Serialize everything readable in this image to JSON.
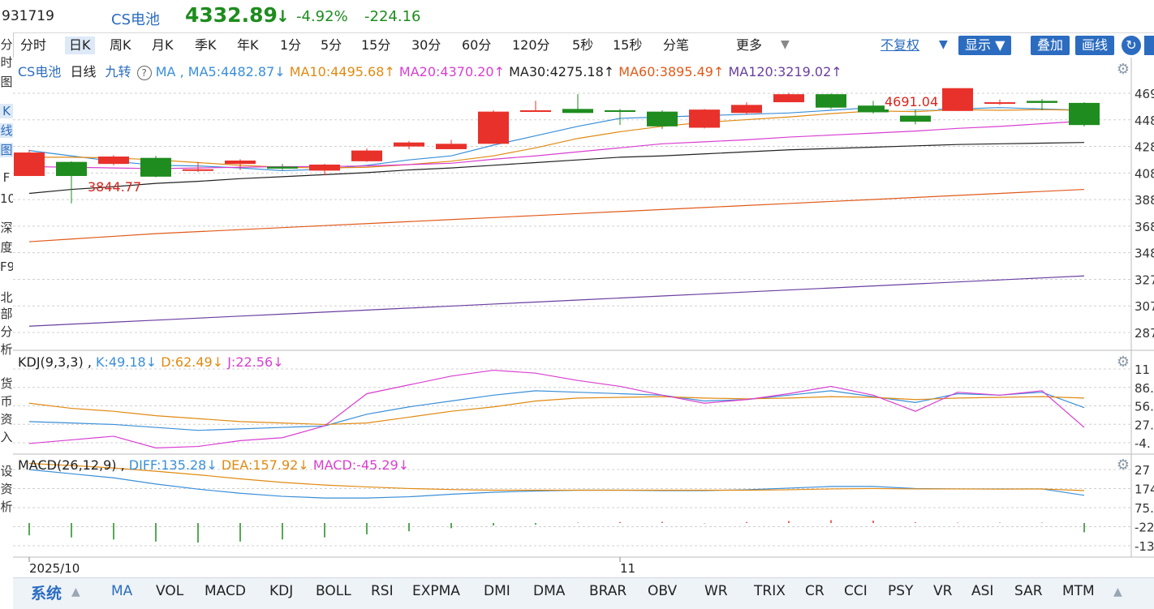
{
  "header": {
    "code": "931719",
    "name": "CS电池",
    "price": "4332.89",
    "arrow": "↓",
    "pct": "-4.92%",
    "change": "-224.16"
  },
  "periods": [
    "分时",
    "日K",
    "周K",
    "月K",
    "季K",
    "年K",
    "1分",
    "5分",
    "15分",
    "30分",
    "60分",
    "120分",
    "5秒",
    "15秒",
    "分笔"
  ],
  "active_period": "日K",
  "more_label": "更多",
  "fq_label": "不复权",
  "buttons": {
    "show": "显示",
    "overlay": "叠加",
    "draw": "画线"
  },
  "left_strip": [
    "分",
    "时",
    "图",
    "K",
    "线",
    "图",
    "F",
    "10",
    "深",
    "度",
    "F9",
    "北",
    "部",
    "分",
    "析",
    "货",
    "币",
    "资",
    "入",
    "设",
    "资",
    "析"
  ],
  "main_legend": {
    "name": "CS电池",
    "period": "日线",
    "indicator": "九转",
    "ma_label": "MA ,",
    "ma5": "MA5:4482.87↓",
    "ma10": "MA10:4495.68↑",
    "ma20": "MA20:4370.20↑",
    "ma30": "MA30:4275.18↑",
    "ma60": "MA60:3895.49↑",
    "ma120": "MA120:3219.02↑"
  },
  "annotations": {
    "high": "4691.04",
    "low": "3844.77"
  },
  "kdj_legend": {
    "name": "KDJ(9,3,3) ,",
    "k": "K:49.18↓",
    "d": "D:62.49↓",
    "j": "J:22.56↓"
  },
  "macd_legend": {
    "name": "MACD(26,12,9) ,",
    "diff": "DIFF:135.28↓",
    "dea": "DEA:157.92↓",
    "macd": "MACD:-45.29↓"
  },
  "price_axis": [
    "469",
    "448",
    "428",
    "408",
    "388",
    "368",
    "348",
    "327",
    "307",
    "287"
  ],
  "kdj_axis": [
    "11",
    "86.",
    "56.",
    "27.",
    "-4."
  ],
  "macd_axis": [
    "27",
    "174",
    "75.",
    "-22",
    "-13"
  ],
  "date_labels": [
    "2025/10",
    "11"
  ],
  "bottom_tabs": [
    "系统",
    "MA",
    "VOL",
    "MACD",
    "KDJ",
    "BOLL",
    "RSI",
    "EXPMA",
    "DMI",
    "DMA",
    "BRAR",
    "OBV",
    "WR",
    "TRIX",
    "CR",
    "CCI",
    "PSY",
    "VR",
    "ASI",
    "SAR",
    "MTM"
  ],
  "colors": {
    "up": "#e8312a",
    "down": "#1e8c1e",
    "ma5": "#3a8fd8",
    "ma10": "#e08a12",
    "ma20": "#d83fd0",
    "ma30": "#222222",
    "ma60": "#e05a1a",
    "ma120": "#6a3fa0",
    "blue_btn": "#2b6cc0"
  },
  "chart_data": {
    "type": "candlestick",
    "ylim": [
      2750,
      4800
    ],
    "candles": [
      {
        "o": 4050,
        "c": 4225,
        "h": 4245,
        "l": 4050
      },
      {
        "o": 4155,
        "c": 4050,
        "h": 4160,
        "l": 3845
      },
      {
        "o": 4140,
        "c": 4195,
        "h": 4205,
        "l": 4130
      },
      {
        "o": 4185,
        "c": 4045,
        "h": 4200,
        "l": 4040
      },
      {
        "o": 4095,
        "c": 4100,
        "h": 4155,
        "l": 4080
      },
      {
        "o": 4140,
        "c": 4165,
        "h": 4175,
        "l": 4095
      },
      {
        "o": 4120,
        "c": 4105,
        "h": 4140,
        "l": 4095
      },
      {
        "o": 4090,
        "c": 4135,
        "h": 4140,
        "l": 4055
      },
      {
        "o": 4160,
        "c": 4240,
        "h": 4255,
        "l": 4155
      },
      {
        "o": 4270,
        "c": 4300,
        "h": 4310,
        "l": 4250
      },
      {
        "o": 4250,
        "c": 4290,
        "h": 4320,
        "l": 4250
      },
      {
        "o": 4290,
        "c": 4530,
        "h": 4540,
        "l": 4290
      },
      {
        "o": 4540,
        "c": 4540,
        "h": 4610,
        "l": 4530
      },
      {
        "o": 4550,
        "c": 4520,
        "h": 4660,
        "l": 4520
      },
      {
        "o": 4540,
        "c": 4530,
        "h": 4550,
        "l": 4430
      },
      {
        "o": 4530,
        "c": 4420,
        "h": 4540,
        "l": 4400
      },
      {
        "o": 4410,
        "c": 4545,
        "h": 4550,
        "l": 4405
      },
      {
        "o": 4520,
        "c": 4580,
        "h": 4600,
        "l": 4510
      },
      {
        "o": 4600,
        "c": 4660,
        "h": 4670,
        "l": 4600
      },
      {
        "o": 4660,
        "c": 4560,
        "h": 4665,
        "l": 4550
      },
      {
        "o": 4575,
        "c": 4525,
        "h": 4610,
        "l": 4515
      },
      {
        "o": 4500,
        "c": 4455,
        "h": 4550,
        "l": 4435
      },
      {
        "o": 4535,
        "c": 4705,
        "h": 4691,
        "l": 4535
      },
      {
        "o": 4590,
        "c": 4600,
        "h": 4620,
        "l": 4580
      },
      {
        "o": 4610,
        "c": 4595,
        "h": 4625,
        "l": 4540
      },
      {
        "o": 4595,
        "c": 4430,
        "h": 4600,
        "l": 4420
      }
    ],
    "ma_series": [
      {
        "key": "ma5",
        "values": [
          4240,
          4200,
          4160,
          4130,
          4125,
          4110,
          4090,
          4100,
          4130,
          4170,
          4200,
          4280,
          4350,
          4420,
          4480,
          4490,
          4500,
          4510,
          4520,
          4540,
          4560,
          4545,
          4550,
          4560,
          4550,
          4540
        ]
      },
      {
        "key": "ma10",
        "values": [
          4190,
          4190,
          4185,
          4170,
          4150,
          4130,
          4115,
          4110,
          4115,
          4135,
          4160,
          4200,
          4260,
          4330,
          4380,
          4420,
          4450,
          4470,
          4490,
          4515,
          4535,
          4530,
          4545,
          4540,
          4545,
          4540
        ]
      },
      {
        "key": "ma20",
        "values": [
          4120,
          4115,
          4110,
          4105,
          4110,
          4115,
          4120,
          4120,
          4125,
          4135,
          4145,
          4175,
          4200,
          4230,
          4260,
          4290,
          4305,
          4320,
          4340,
          4355,
          4370,
          4385,
          4405,
          4420,
          4440,
          4460
        ]
      },
      {
        "key": "ma30",
        "values": [
          3920,
          3950,
          3970,
          3995,
          4010,
          4030,
          4045,
          4060,
          4075,
          4095,
          4110,
          4130,
          4150,
          4170,
          4190,
          4200,
          4215,
          4230,
          4245,
          4255,
          4265,
          4275,
          4285,
          4290,
          4295,
          4300
        ]
      },
      {
        "key": "ma60",
        "values": [
          3560,
          3580,
          3600,
          3620,
          3635,
          3650,
          3665,
          3680,
          3695,
          3710,
          3725,
          3740,
          3755,
          3770,
          3785,
          3800,
          3815,
          3830,
          3845,
          3860,
          3875,
          3890,
          3905,
          3920,
          3935,
          3950
        ]
      },
      {
        "key": "ma120",
        "values": [
          2930,
          2945,
          2960,
          2975,
          2990,
          3005,
          3020,
          3035,
          3050,
          3065,
          3080,
          3095,
          3110,
          3125,
          3140,
          3155,
          3170,
          3185,
          3200,
          3215,
          3230,
          3245,
          3260,
          3275,
          3290,
          3305
        ]
      }
    ],
    "kdj": {
      "ylim": [
        -10,
        115
      ],
      "k": [
        30,
        28,
        26,
        22,
        18,
        20,
        22,
        24,
        40,
        50,
        58,
        66,
        72,
        70,
        68,
        66,
        58,
        60,
        66,
        72,
        64,
        56,
        68,
        66,
        70,
        49
      ],
      "d": [
        55,
        48,
        44,
        38,
        34,
        30,
        28,
        26,
        28,
        36,
        44,
        50,
        58,
        62,
        63,
        64,
        62,
        61,
        62,
        64,
        63,
        60,
        62,
        63,
        64,
        62
      ],
      "j": [
        0,
        5,
        10,
        -6,
        -4,
        4,
        8,
        24,
        68,
        80,
        92,
        100,
        96,
        86,
        78,
        66,
        55,
        60,
        68,
        78,
        66,
        44,
        70,
        66,
        72,
        22
      ]
    },
    "macd": {
      "ylim": [
        -150,
        300
      ],
      "diff": [
        260,
        240,
        220,
        190,
        165,
        145,
        130,
        122,
        122,
        128,
        140,
        150,
        156,
        160,
        160,
        158,
        158,
        162,
        170,
        178,
        178,
        168,
        166,
        166,
        166,
        135
      ],
      "dea": [
        290,
        280,
        268,
        252,
        235,
        215,
        198,
        185,
        176,
        168,
        163,
        160,
        160,
        160,
        160,
        160,
        160,
        160,
        162,
        166,
        168,
        166,
        166,
        165,
        166,
        158
      ],
      "hist": [
        -60,
        -70,
        -80,
        -90,
        -95,
        -90,
        -80,
        -70,
        -55,
        -40,
        -25,
        -12,
        -8,
        2,
        5,
        6,
        -2,
        5,
        10,
        14,
        12,
        4,
        2,
        2,
        2,
        -45
      ]
    }
  }
}
